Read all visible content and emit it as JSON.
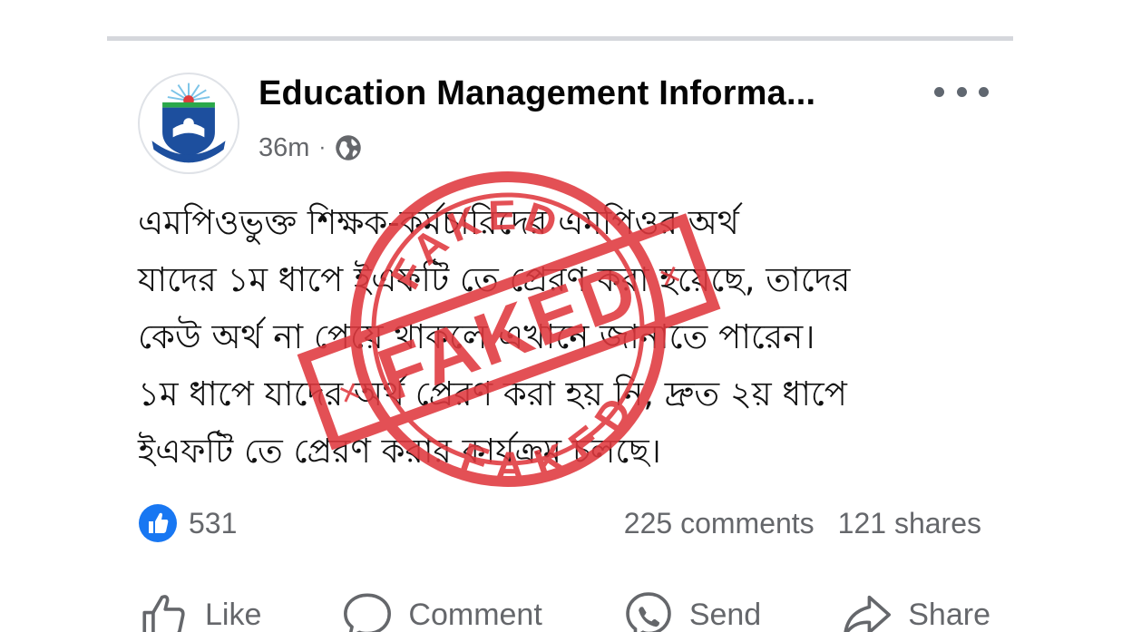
{
  "post": {
    "page_name": "Education Management Informa...",
    "time": "36m",
    "separator": "·",
    "privacy_icon": "globe-icon",
    "body_lines": [
      "এমপিওভুক্ত শিক্ষক-কর্মচারিদের এমপিওর অর্থ",
      "যাদের ১ম ধাপে ইএফটি তে প্রেরণ করা হয়েছে, তাদের",
      "কেউ অর্থ না পেয়ে থাকলে এখানে জানাতে পারেন।",
      "১ম ধাপে যাদের অর্থ প্রেরণ করা হয় নি, দ্রুত ২য় ধাপে",
      "ইএফটি তে প্রেরণ করার কার্যক্রম চলছে।"
    ]
  },
  "stats": {
    "reactions": "531",
    "comments": "225 comments",
    "shares": "121 shares"
  },
  "actions": {
    "like": "Like",
    "comment": "Comment",
    "send": "Send",
    "share": "Share"
  },
  "stamp": {
    "top_text": "FAKED",
    "center_text": "FAKED",
    "bottom_text": "FAKED",
    "color": "#e0383e"
  },
  "colors": {
    "like_blue": "#1877f2",
    "muted_text": "#65676b"
  }
}
